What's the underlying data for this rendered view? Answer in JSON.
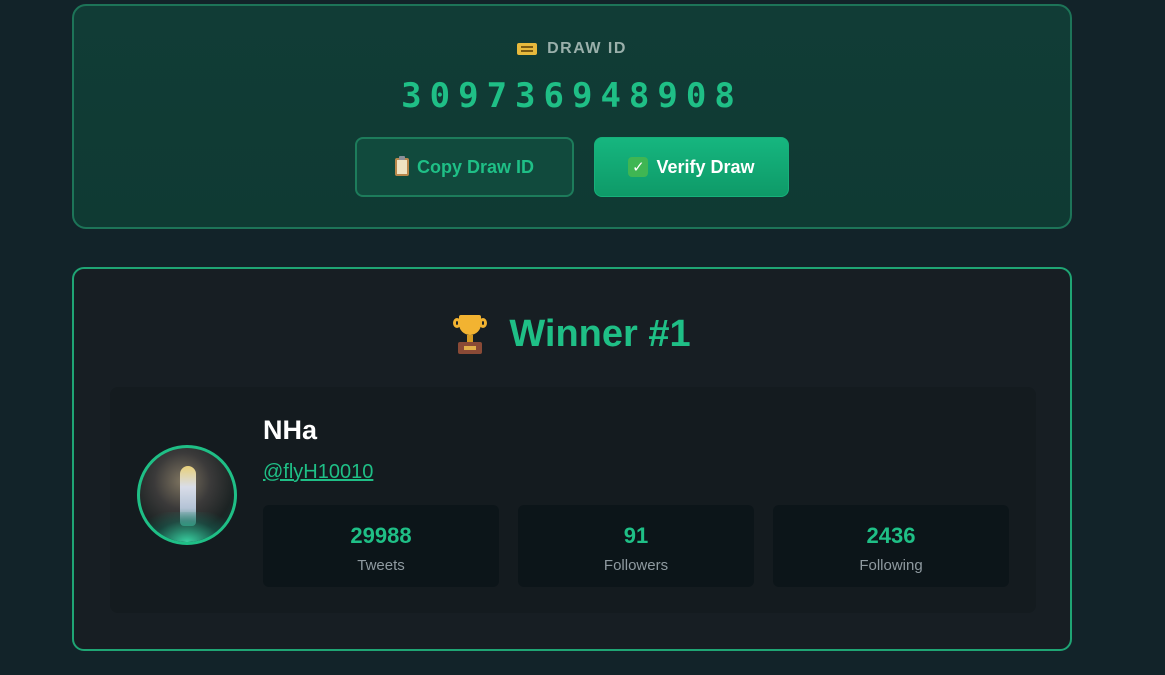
{
  "draw": {
    "label": "DRAW ID",
    "id": "309736948908",
    "copy_button": "Copy Draw ID",
    "verify_button": "Verify Draw"
  },
  "winner": {
    "title": "Winner #1",
    "name": "NHa",
    "handle": "@flyH10010",
    "stats": [
      {
        "value": "29988",
        "label": "Tweets"
      },
      {
        "value": "91",
        "label": "Followers"
      },
      {
        "value": "2436",
        "label": "Following"
      }
    ]
  },
  "icons": {
    "draw_label": "ticket-icon",
    "copy": "clipboard-icon",
    "verify": "check-icon",
    "winner": "trophy-icon"
  },
  "colors": {
    "accent": "#1fbf86",
    "background": "#122329"
  }
}
